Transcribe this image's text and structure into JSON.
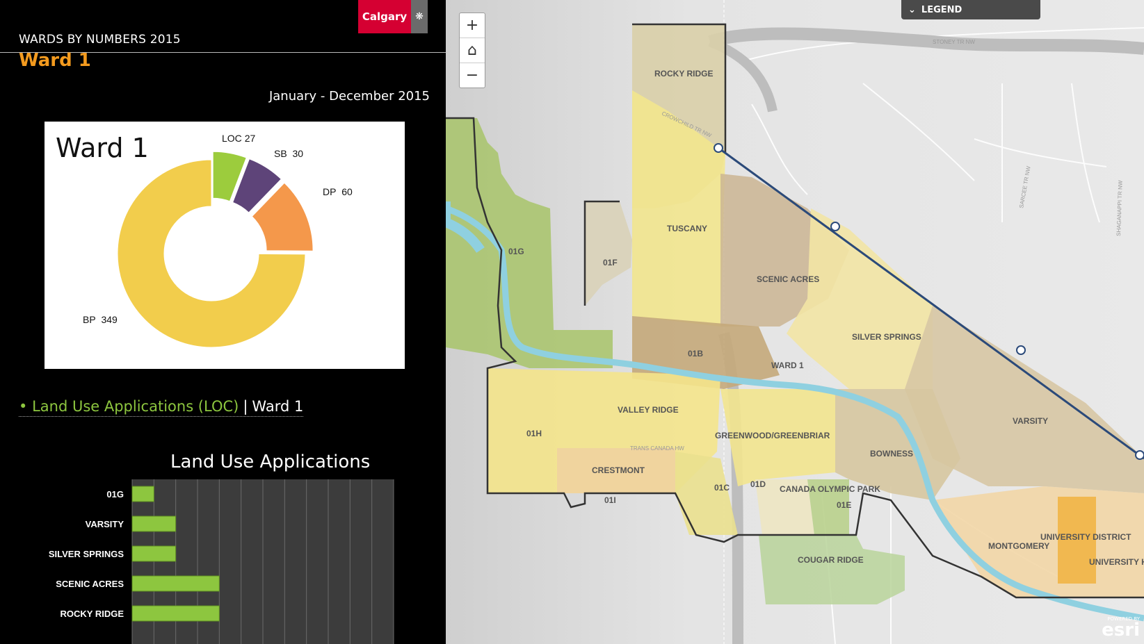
{
  "header": {
    "app_title": "WARDS BY NUMBERS 2015",
    "ward_title": "Ward 1",
    "date_range": "January - December 2015",
    "logo_text": "Calgary"
  },
  "donut": {
    "title": "Ward 1",
    "slices": [
      {
        "label": "LOC",
        "value": 27,
        "color": "#9ccc3d"
      },
      {
        "label": "SB",
        "value": 30,
        "color": "#5e4479"
      },
      {
        "label": "DP",
        "value": 60,
        "color": "#f4984b"
      },
      {
        "label": "BP",
        "value": 349,
        "color": "#f2cd4c"
      }
    ]
  },
  "section_link": {
    "label": "Land Use Applications (LOC)",
    "separator": "|",
    "ward": "Ward 1"
  },
  "chart_data": {
    "type": "bar",
    "title": "Land Use Applications",
    "orientation": "horizontal",
    "categories": [
      "01G",
      "VARSITY",
      "SILVER SPRINGS",
      "SCENIC ACRES",
      "ROCKY RIDGE"
    ],
    "values": [
      1,
      2,
      2,
      4,
      4
    ],
    "xlim": [
      0,
      12
    ],
    "grid": true
  },
  "map": {
    "zoom_in": "+",
    "home": "⌂",
    "zoom_out": "−",
    "legend_label": "LEGEND",
    "esri_small": "POWERED BY",
    "esri_big": "esri",
    "labels": {
      "rocky_ridge": "ROCKY RIDGE",
      "tuscany": "TUSCANY",
      "scenic_acres": "SCENIC ACRES",
      "silver_springs": "SILVER SPRINGS",
      "ward1": "WARD 1",
      "valley_ridge": "VALLEY RIDGE",
      "greenwood": "GREENWOOD/GREENBRIAR",
      "bowness": "BOWNESS",
      "varsity": "VARSITY",
      "crestmont": "CRESTMONT",
      "cougar_ridge": "COUGAR RIDGE",
      "montgomery": "MONTGOMERY",
      "univ_district": "UNIVERSITY DISTRICT",
      "univ_h": "UNIVERSITY H",
      "canada_olympic_park": "CANADA OLYMPIC PARK",
      "z01g": "01G",
      "z01f": "01F",
      "z01b": "01B",
      "z01h": "01H",
      "z01i": "01I",
      "z01c": "01C",
      "z01d": "01D",
      "z01e": "01E",
      "road_stoney": "STONEY TR NW",
      "road_crowchild": "CROWCHILD TR NW",
      "road_sarcee": "SARCEE TR NW",
      "road_shaganappi": "SHAGANAPPI TR NW",
      "road_transcanada": "TRANS CANADA HW"
    }
  }
}
